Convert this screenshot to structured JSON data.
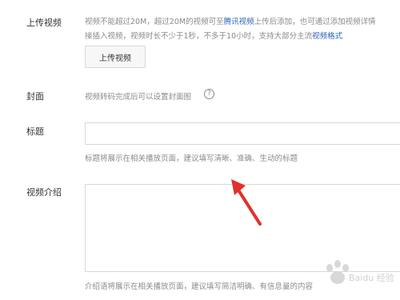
{
  "upload_video": {
    "label": "上传视频",
    "hint_line1_a": "视频不能超过20M，超过20M的视频可至",
    "hint_line1_link": "腾讯视频",
    "hint_line1_b": "上传后添加，也可通过添加视频详情",
    "hint_line2_a": "接插入视频，视频时长不少于1秒，不多于10小时，支持大部分主流",
    "hint_line2_link": "视频格式",
    "button_label": "上传视频"
  },
  "cover": {
    "label": "封面",
    "hint": "视频转码完成后可以设置封面图",
    "help_glyph": "?"
  },
  "title": {
    "label": "标题",
    "value": "",
    "hint": "标题将展示在相关播放页面，建议填写清晰、准确、生动的标题"
  },
  "intro": {
    "label": "视频介绍",
    "value": "",
    "hint": "介绍语将展示在相关播放页面，建议填写简洁明确、有信息量的内容"
  },
  "annotation": {
    "arrow_color": "#e0322c"
  },
  "watermark": {
    "icon": "baidu-paw-icon",
    "text": "Baidu 经验"
  }
}
